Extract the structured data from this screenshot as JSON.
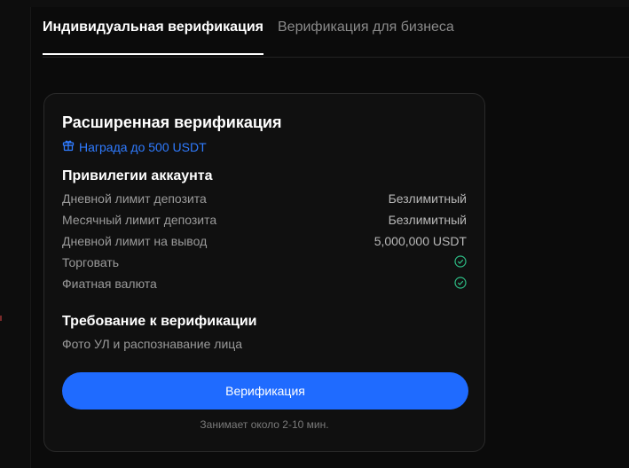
{
  "tabs": [
    {
      "label": "Индивидуальная верификация",
      "active": true
    },
    {
      "label": "Верификация для бизнеса",
      "active": false
    }
  ],
  "card": {
    "title": "Расширенная верификация",
    "reward": {
      "icon": "gift-icon",
      "text": "Награда до 500 USDT"
    },
    "privileges": {
      "heading": "Привилегии аккаунта",
      "rows": [
        {
          "label": "Дневной лимит депозита",
          "value": "Безлимитный"
        },
        {
          "label": "Месячный лимит депозита",
          "value": "Безлимитный"
        },
        {
          "label": "Дневной лимит на вывод",
          "value": "5,000,000 USDT"
        },
        {
          "label": "Торговать",
          "icon": "check-circle-icon"
        },
        {
          "label": "Фиатная валюта",
          "icon": "check-circle-icon"
        }
      ]
    },
    "requirement": {
      "heading": "Требование к верификации",
      "description": "Фото УЛ и распознавание лица"
    },
    "button_label": "Верификация",
    "duration_note": "Занимает около 2-10 мин."
  },
  "colors": {
    "accent": "#1f6bff",
    "reward_text": "#2f7bff",
    "check": "#2ebd85",
    "background": "#0b0b0b"
  }
}
